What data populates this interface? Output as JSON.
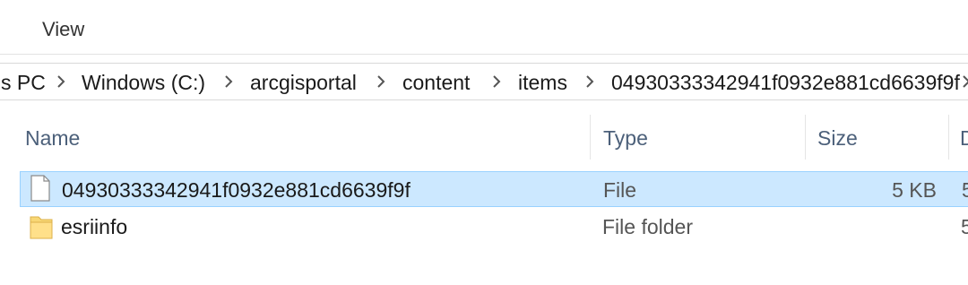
{
  "ribbon": {
    "tabs": [
      {
        "label": "View"
      }
    ]
  },
  "address": {
    "crumbs": [
      {
        "label": "s PC"
      },
      {
        "label": "Windows (C:)"
      },
      {
        "label": "arcgisportal"
      },
      {
        "label": "content"
      },
      {
        "label": "items"
      },
      {
        "label": "04930333342941f0932e881cd6639f9f"
      }
    ]
  },
  "list": {
    "columns": [
      {
        "label": "Name"
      },
      {
        "label": "Type"
      },
      {
        "label": "Size"
      },
      {
        "label": "D"
      }
    ],
    "rows": [
      {
        "name": "04930333342941f0932e881cd6639f9f",
        "type": "File",
        "size": "5 KB",
        "date": "5",
        "icon": "file-icon",
        "selected": true
      },
      {
        "name": "esriinfo",
        "type": "File folder",
        "size": "",
        "date": "5",
        "icon": "folder-icon",
        "selected": false
      }
    ]
  },
  "colors": {
    "selection_bg": "#cce8ff",
    "selection_border": "#99d1ff",
    "header_text": "#4c607a",
    "folder": "#f8d775"
  }
}
